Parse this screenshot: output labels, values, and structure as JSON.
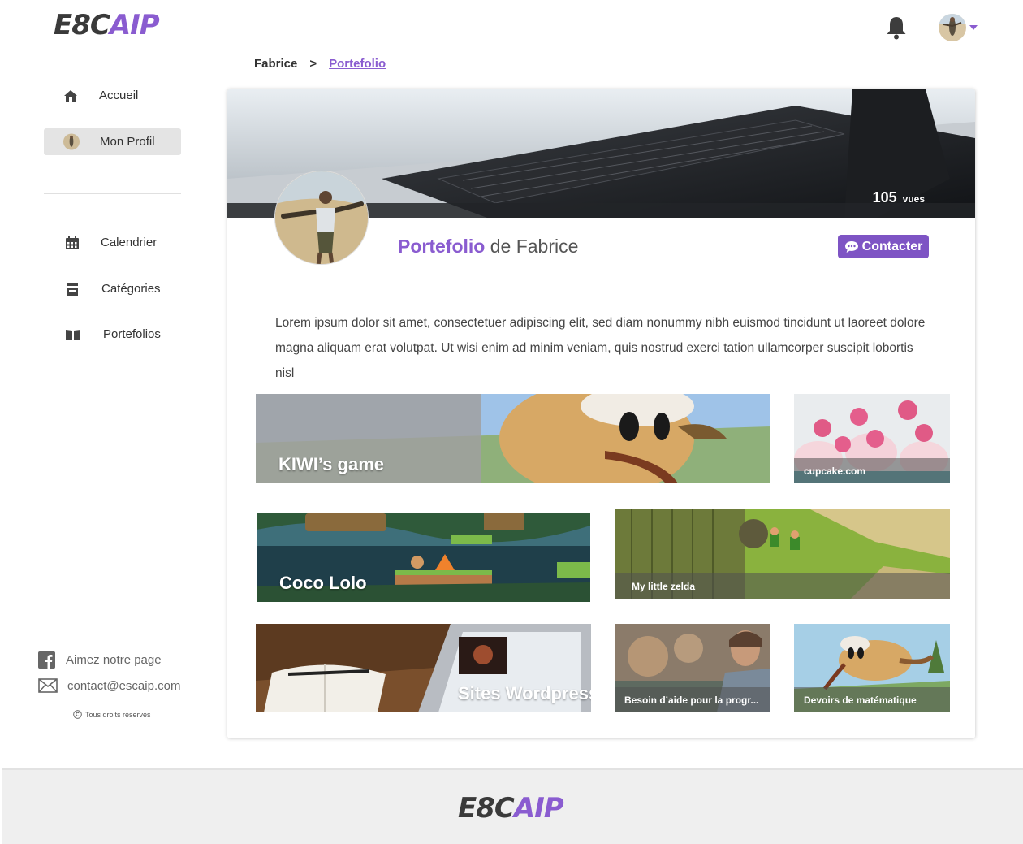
{
  "header": {
    "logo_dark": "E8C",
    "logo_purple": "AIP"
  },
  "sidebar": {
    "items": [
      {
        "label": "Accueil",
        "icon": "home-icon"
      },
      {
        "label": "Mon Profil",
        "icon": "avatar",
        "active": true
      },
      {
        "label": "Calendrier",
        "icon": "calendar-icon"
      },
      {
        "label": "Catégories",
        "icon": "shop-icon"
      },
      {
        "label": "Portefolios",
        "icon": "book-icon"
      }
    ],
    "like_page": "Aimez notre page",
    "contact_email": "contact@escaip.com",
    "copyright": "Tous droits réservés"
  },
  "breadcrumb": {
    "first": "Fabrice",
    "separator": ">",
    "current": "Portefolio"
  },
  "profile": {
    "views_count": "105",
    "views_label": "vues",
    "title_accent": "Portefolio",
    "title_rest": " de Fabrice",
    "contact_button": "Contacter",
    "description": "Lorem ipsum dolor sit amet, consectetuer adipiscing elit, sed diam nonummy nibh euismod tincidunt ut laoreet dolore magna aliquam erat volutpat. Ut wisi enim ad minim veniam, quis nostrud exerci tation ullamcorper suscipit lobortis nisl"
  },
  "projects": [
    {
      "title": "KIWI’s game"
    },
    {
      "title": "cupcake.com"
    },
    {
      "title": "Coco Lolo"
    },
    {
      "title": "My little  zelda"
    },
    {
      "title": "Sites Wordpress"
    },
    {
      "title": "Besoin d’aide pour la progr..."
    },
    {
      "title": "Devoirs de matématique"
    }
  ],
  "footer": {
    "logo_dark": "E8C",
    "logo_purple": "AIP"
  },
  "colors": {
    "accent": "#8a5cd0",
    "button": "#7e54c4"
  }
}
